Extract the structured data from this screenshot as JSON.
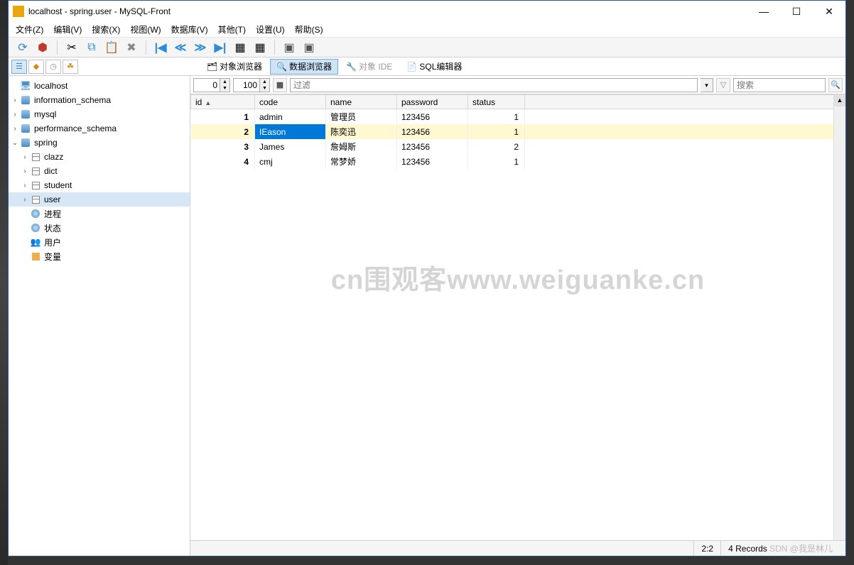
{
  "window": {
    "title": "localhost - spring.user - MySQL-Front"
  },
  "menu": {
    "file": "文件(Z)",
    "edit": "编辑(V)",
    "search": "搜索(X)",
    "view": "视图(W)",
    "database": "数据库(V)",
    "other": "其他(T)",
    "settings": "设置(U)",
    "help": "帮助(S)"
  },
  "view_tabs": {
    "object": "对象浏览器",
    "data": "数据浏览器",
    "ide": "对象 IDE",
    "sql": "SQL编辑器"
  },
  "filter": {
    "offset": "0",
    "limit": "100",
    "placeholder": "过滤",
    "search_placeholder": "搜索"
  },
  "tree": {
    "host": "localhost",
    "db1": "information_schema",
    "db2": "mysql",
    "db3": "performance_schema",
    "db4": "spring",
    "t1": "clazz",
    "t2": "dict",
    "t3": "student",
    "t4": "user",
    "proc": "进程",
    "status": "状态",
    "users": "用户",
    "vars": "变量"
  },
  "columns": {
    "id": "id",
    "code": "code",
    "name": "name",
    "password": "password",
    "status": "status"
  },
  "rows": [
    {
      "id": "1",
      "code": "admin",
      "name": "管理员",
      "password": "123456",
      "status": "1"
    },
    {
      "id": "2",
      "code": "IEason",
      "name": "陈奕迅",
      "password": "123456",
      "status": "1"
    },
    {
      "id": "3",
      "code": "James",
      "name": "詹姆斯",
      "password": "123456",
      "status": "2"
    },
    {
      "id": "4",
      "code": "cmj",
      "name": "常梦娇",
      "password": "123456",
      "status": "1"
    }
  ],
  "status": {
    "pos": "2:2",
    "count": "4 Records"
  },
  "watermark": "cn围观客www.weiguanke.cn",
  "credit": "SDN @我是林儿"
}
